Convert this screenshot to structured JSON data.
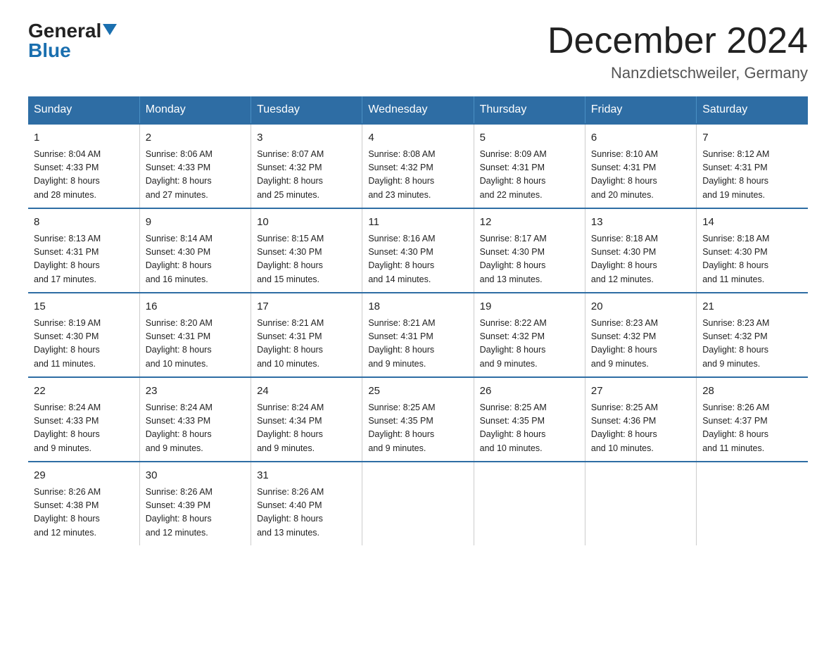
{
  "header": {
    "logo_general": "General",
    "logo_blue": "Blue",
    "month_title": "December 2024",
    "location": "Nanzdietschweiler, Germany"
  },
  "weekdays": [
    "Sunday",
    "Monday",
    "Tuesday",
    "Wednesday",
    "Thursday",
    "Friday",
    "Saturday"
  ],
  "weeks": [
    [
      {
        "day": "1",
        "sunrise": "Sunrise: 8:04 AM",
        "sunset": "Sunset: 4:33 PM",
        "daylight": "Daylight: 8 hours",
        "minutes": "and 28 minutes."
      },
      {
        "day": "2",
        "sunrise": "Sunrise: 8:06 AM",
        "sunset": "Sunset: 4:33 PM",
        "daylight": "Daylight: 8 hours",
        "minutes": "and 27 minutes."
      },
      {
        "day": "3",
        "sunrise": "Sunrise: 8:07 AM",
        "sunset": "Sunset: 4:32 PM",
        "daylight": "Daylight: 8 hours",
        "minutes": "and 25 minutes."
      },
      {
        "day": "4",
        "sunrise": "Sunrise: 8:08 AM",
        "sunset": "Sunset: 4:32 PM",
        "daylight": "Daylight: 8 hours",
        "minutes": "and 23 minutes."
      },
      {
        "day": "5",
        "sunrise": "Sunrise: 8:09 AM",
        "sunset": "Sunset: 4:31 PM",
        "daylight": "Daylight: 8 hours",
        "minutes": "and 22 minutes."
      },
      {
        "day": "6",
        "sunrise": "Sunrise: 8:10 AM",
        "sunset": "Sunset: 4:31 PM",
        "daylight": "Daylight: 8 hours",
        "minutes": "and 20 minutes."
      },
      {
        "day": "7",
        "sunrise": "Sunrise: 8:12 AM",
        "sunset": "Sunset: 4:31 PM",
        "daylight": "Daylight: 8 hours",
        "minutes": "and 19 minutes."
      }
    ],
    [
      {
        "day": "8",
        "sunrise": "Sunrise: 8:13 AM",
        "sunset": "Sunset: 4:31 PM",
        "daylight": "Daylight: 8 hours",
        "minutes": "and 17 minutes."
      },
      {
        "day": "9",
        "sunrise": "Sunrise: 8:14 AM",
        "sunset": "Sunset: 4:30 PM",
        "daylight": "Daylight: 8 hours",
        "minutes": "and 16 minutes."
      },
      {
        "day": "10",
        "sunrise": "Sunrise: 8:15 AM",
        "sunset": "Sunset: 4:30 PM",
        "daylight": "Daylight: 8 hours",
        "minutes": "and 15 minutes."
      },
      {
        "day": "11",
        "sunrise": "Sunrise: 8:16 AM",
        "sunset": "Sunset: 4:30 PM",
        "daylight": "Daylight: 8 hours",
        "minutes": "and 14 minutes."
      },
      {
        "day": "12",
        "sunrise": "Sunrise: 8:17 AM",
        "sunset": "Sunset: 4:30 PM",
        "daylight": "Daylight: 8 hours",
        "minutes": "and 13 minutes."
      },
      {
        "day": "13",
        "sunrise": "Sunrise: 8:18 AM",
        "sunset": "Sunset: 4:30 PM",
        "daylight": "Daylight: 8 hours",
        "minutes": "and 12 minutes."
      },
      {
        "day": "14",
        "sunrise": "Sunrise: 8:18 AM",
        "sunset": "Sunset: 4:30 PM",
        "daylight": "Daylight: 8 hours",
        "minutes": "and 11 minutes."
      }
    ],
    [
      {
        "day": "15",
        "sunrise": "Sunrise: 8:19 AM",
        "sunset": "Sunset: 4:30 PM",
        "daylight": "Daylight: 8 hours",
        "minutes": "and 11 minutes."
      },
      {
        "day": "16",
        "sunrise": "Sunrise: 8:20 AM",
        "sunset": "Sunset: 4:31 PM",
        "daylight": "Daylight: 8 hours",
        "minutes": "and 10 minutes."
      },
      {
        "day": "17",
        "sunrise": "Sunrise: 8:21 AM",
        "sunset": "Sunset: 4:31 PM",
        "daylight": "Daylight: 8 hours",
        "minutes": "and 10 minutes."
      },
      {
        "day": "18",
        "sunrise": "Sunrise: 8:21 AM",
        "sunset": "Sunset: 4:31 PM",
        "daylight": "Daylight: 8 hours",
        "minutes": "and 9 minutes."
      },
      {
        "day": "19",
        "sunrise": "Sunrise: 8:22 AM",
        "sunset": "Sunset: 4:32 PM",
        "daylight": "Daylight: 8 hours",
        "minutes": "and 9 minutes."
      },
      {
        "day": "20",
        "sunrise": "Sunrise: 8:23 AM",
        "sunset": "Sunset: 4:32 PM",
        "daylight": "Daylight: 8 hours",
        "minutes": "and 9 minutes."
      },
      {
        "day": "21",
        "sunrise": "Sunrise: 8:23 AM",
        "sunset": "Sunset: 4:32 PM",
        "daylight": "Daylight: 8 hours",
        "minutes": "and 9 minutes."
      }
    ],
    [
      {
        "day": "22",
        "sunrise": "Sunrise: 8:24 AM",
        "sunset": "Sunset: 4:33 PM",
        "daylight": "Daylight: 8 hours",
        "minutes": "and 9 minutes."
      },
      {
        "day": "23",
        "sunrise": "Sunrise: 8:24 AM",
        "sunset": "Sunset: 4:33 PM",
        "daylight": "Daylight: 8 hours",
        "minutes": "and 9 minutes."
      },
      {
        "day": "24",
        "sunrise": "Sunrise: 8:24 AM",
        "sunset": "Sunset: 4:34 PM",
        "daylight": "Daylight: 8 hours",
        "minutes": "and 9 minutes."
      },
      {
        "day": "25",
        "sunrise": "Sunrise: 8:25 AM",
        "sunset": "Sunset: 4:35 PM",
        "daylight": "Daylight: 8 hours",
        "minutes": "and 9 minutes."
      },
      {
        "day": "26",
        "sunrise": "Sunrise: 8:25 AM",
        "sunset": "Sunset: 4:35 PM",
        "daylight": "Daylight: 8 hours",
        "minutes": "and 10 minutes."
      },
      {
        "day": "27",
        "sunrise": "Sunrise: 8:25 AM",
        "sunset": "Sunset: 4:36 PM",
        "daylight": "Daylight: 8 hours",
        "minutes": "and 10 minutes."
      },
      {
        "day": "28",
        "sunrise": "Sunrise: 8:26 AM",
        "sunset": "Sunset: 4:37 PM",
        "daylight": "Daylight: 8 hours",
        "minutes": "and 11 minutes."
      }
    ],
    [
      {
        "day": "29",
        "sunrise": "Sunrise: 8:26 AM",
        "sunset": "Sunset: 4:38 PM",
        "daylight": "Daylight: 8 hours",
        "minutes": "and 12 minutes."
      },
      {
        "day": "30",
        "sunrise": "Sunrise: 8:26 AM",
        "sunset": "Sunset: 4:39 PM",
        "daylight": "Daylight: 8 hours",
        "minutes": "and 12 minutes."
      },
      {
        "day": "31",
        "sunrise": "Sunrise: 8:26 AM",
        "sunset": "Sunset: 4:40 PM",
        "daylight": "Daylight: 8 hours",
        "minutes": "and 13 minutes."
      },
      {
        "day": "",
        "sunrise": "",
        "sunset": "",
        "daylight": "",
        "minutes": ""
      },
      {
        "day": "",
        "sunrise": "",
        "sunset": "",
        "daylight": "",
        "minutes": ""
      },
      {
        "day": "",
        "sunrise": "",
        "sunset": "",
        "daylight": "",
        "minutes": ""
      },
      {
        "day": "",
        "sunrise": "",
        "sunset": "",
        "daylight": "",
        "minutes": ""
      }
    ]
  ]
}
